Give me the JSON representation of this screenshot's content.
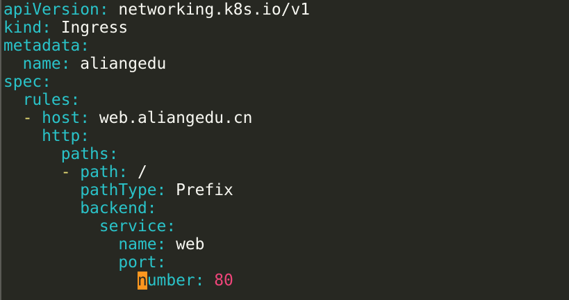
{
  "editor": {
    "cursor_line": 15,
    "colors": {
      "background": "#272822",
      "key": "#2ac3c9",
      "value": "#f8f8f2",
      "dash": "#e6db74",
      "number": "#f0457a",
      "cursor": "#fd971f"
    },
    "lines": [
      {
        "indent": "",
        "dash": "",
        "key": "apiVersion",
        "sep": ":",
        "value": " networking.k8s.io/v1",
        "num": ""
      },
      {
        "indent": "",
        "dash": "",
        "key": "kind",
        "sep": ":",
        "value": " Ingress",
        "num": ""
      },
      {
        "indent": "",
        "dash": "",
        "key": "metadata",
        "sep": ":",
        "value": "",
        "num": ""
      },
      {
        "indent": "  ",
        "dash": "",
        "key": "name",
        "sep": ":",
        "value": " aliangedu",
        "num": ""
      },
      {
        "indent": "",
        "dash": "",
        "key": "spec",
        "sep": ":",
        "value": "",
        "num": ""
      },
      {
        "indent": "  ",
        "dash": "",
        "key": "rules",
        "sep": ":",
        "value": "",
        "num": ""
      },
      {
        "indent": "  ",
        "dash": "- ",
        "key": "host",
        "sep": ":",
        "value": " web.aliangedu.cn",
        "num": ""
      },
      {
        "indent": "    ",
        "dash": "",
        "key": "http",
        "sep": ":",
        "value": "",
        "num": ""
      },
      {
        "indent": "      ",
        "dash": "",
        "key": "paths",
        "sep": ":",
        "value": "",
        "num": ""
      },
      {
        "indent": "      ",
        "dash": "- ",
        "key": "path",
        "sep": ":",
        "value": " /",
        "num": ""
      },
      {
        "indent": "        ",
        "dash": "",
        "key": "pathType",
        "sep": ":",
        "value": " Prefix",
        "num": ""
      },
      {
        "indent": "        ",
        "dash": "",
        "key": "backend",
        "sep": ":",
        "value": "",
        "num": ""
      },
      {
        "indent": "          ",
        "dash": "",
        "key": "service",
        "sep": ":",
        "value": "",
        "num": ""
      },
      {
        "indent": "            ",
        "dash": "",
        "key": "name",
        "sep": ":",
        "value": " web",
        "num": ""
      },
      {
        "indent": "            ",
        "dash": "",
        "key": "port",
        "sep": ":",
        "value": "",
        "num": ""
      },
      {
        "indent": "              ",
        "dash": "",
        "key": "number",
        "sep": ":",
        "value": " ",
        "num": "80"
      }
    ]
  }
}
